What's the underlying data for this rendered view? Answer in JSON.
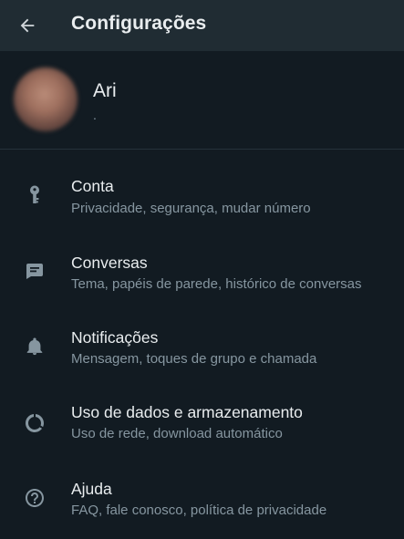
{
  "appbar": {
    "title": "Configurações",
    "back_icon": "arrow-left-icon"
  },
  "profile": {
    "name": "Ari",
    "status": "."
  },
  "menu": [
    {
      "title": "Conta",
      "subtitle": "Privacidade, segurança, mudar número",
      "icon": "key-icon"
    },
    {
      "title": "Conversas",
      "subtitle": "Tema, papéis de parede, histórico de conversas",
      "icon": "chat-icon"
    },
    {
      "title": "Notificações",
      "subtitle": "Mensagem, toques de grupo e chamada",
      "icon": "bell-icon"
    },
    {
      "title": "Uso de dados e armazenamento",
      "subtitle": "Uso de rede, download automático",
      "icon": "data-usage-icon"
    },
    {
      "title": "Ajuda",
      "subtitle": "FAQ, fale conosco, política de privacidade",
      "icon": "help-icon"
    }
  ],
  "colors": {
    "background": "#121b22",
    "appbar": "#202c33",
    "primary_text": "#e9edef",
    "secondary_text": "#8696a0"
  }
}
